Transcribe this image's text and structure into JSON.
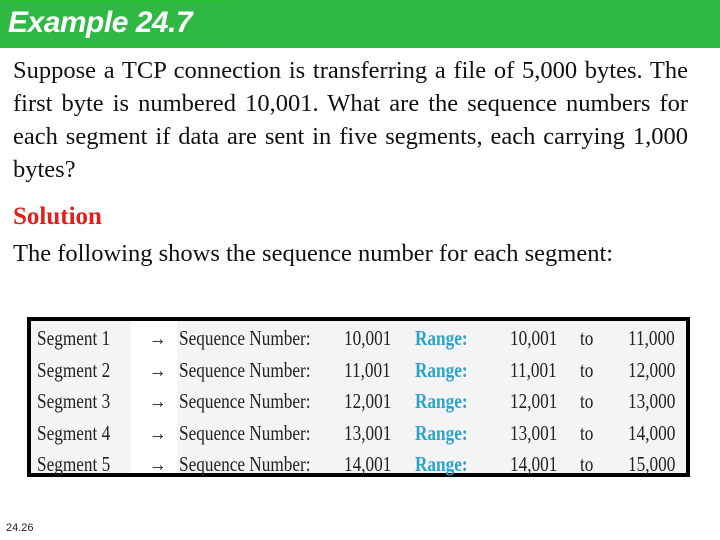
{
  "header": {
    "title": "Example 24.7",
    "color": "#2fb844"
  },
  "question": "Suppose a TCP connection is transferring a file of 5,000 bytes. The first byte is numbered 10,001. What are the sequence numbers for each segment if data are sent in five segments, each carrying 1,000 bytes?",
  "solution_label": "Solution",
  "answer": "The following shows the sequence number for each segment:",
  "table": {
    "rows": [
      {
        "segment": "Segment 1",
        "arrow": "→",
        "seq_label": "Sequence Number:",
        "seq": "10,001",
        "range_label": "Range:",
        "from": "10,001",
        "to": "to",
        "end": "11,000"
      },
      {
        "segment": "Segment 2",
        "arrow": "→",
        "seq_label": "Sequence Number:",
        "seq": "11,001",
        "range_label": "Range:",
        "from": "11,001",
        "to": "to",
        "end": "12,000"
      },
      {
        "segment": "Segment 3",
        "arrow": "→",
        "seq_label": "Sequence Number:",
        "seq": "12,001",
        "range_label": "Range:",
        "from": "12,001",
        "to": "to",
        "end": "13,000"
      },
      {
        "segment": "Segment 4",
        "arrow": "→",
        "seq_label": "Sequence Number:",
        "seq": "13,001",
        "range_label": "Range:",
        "from": "13,001",
        "to": "to",
        "end": "14,000"
      },
      {
        "segment": "Segment 5",
        "arrow": "→",
        "seq_label": "Sequence Number:",
        "seq": "14,001",
        "range_label": "Range:",
        "from": "14,001",
        "to": "to",
        "end": "15,000"
      }
    ]
  },
  "footer": {
    "page": "24.26"
  }
}
